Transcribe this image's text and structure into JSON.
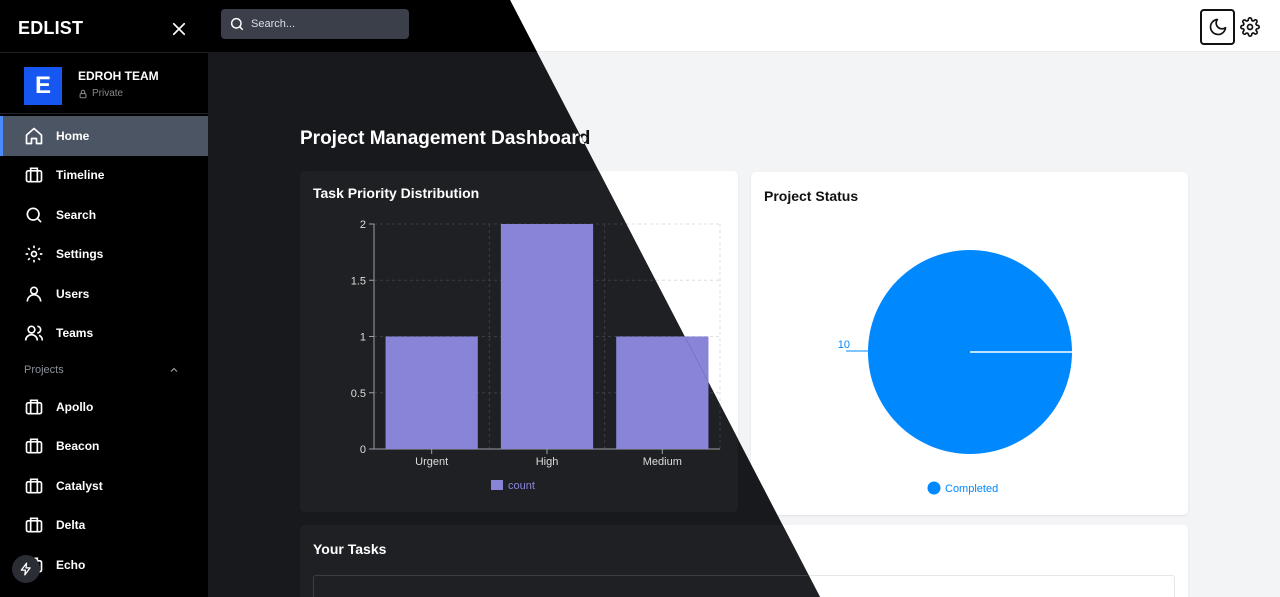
{
  "app": {
    "brand": "EDLIST"
  },
  "team": {
    "logo_letter": "E",
    "name": "EDROH TEAM",
    "visibility": "Private"
  },
  "search": {
    "placeholder": "Search..."
  },
  "nav": {
    "items": [
      {
        "label": "Home",
        "icon": "home-icon"
      },
      {
        "label": "Timeline",
        "icon": "briefcase-icon"
      },
      {
        "label": "Search",
        "icon": "search-icon"
      },
      {
        "label": "Settings",
        "icon": "gear-icon"
      },
      {
        "label": "Users",
        "icon": "user-icon"
      },
      {
        "label": "Teams",
        "icon": "users-icon"
      }
    ],
    "projects_label": "Projects",
    "projects": [
      {
        "label": "Apollo"
      },
      {
        "label": "Beacon"
      },
      {
        "label": "Catalyst"
      },
      {
        "label": "Delta"
      },
      {
        "label": "Echo"
      }
    ]
  },
  "page": {
    "title": "Project Management Dashboard"
  },
  "cards": {
    "priority_title": "Task Priority Distribution",
    "status_title": "Project Status",
    "tasks_title": "Your Tasks"
  },
  "chart_data": [
    {
      "type": "bar",
      "title": "Task Priority Distribution",
      "categories": [
        "Urgent",
        "High",
        "Medium"
      ],
      "series": [
        {
          "name": "count",
          "values": [
            1,
            2,
            1
          ]
        }
      ],
      "ylim": [
        0,
        2
      ],
      "yticks": [
        0,
        0.5,
        1,
        1.5,
        2
      ],
      "ytick_labels": [
        "0",
        "0.5",
        "1",
        "1.5",
        "2"
      ],
      "grid": true,
      "legend": "bottom",
      "color": "#8884d8"
    },
    {
      "type": "pie",
      "title": "Project Status",
      "slices": [
        {
          "label": "Completed",
          "value": 10
        }
      ],
      "data_labels": [
        "10"
      ],
      "legend": "bottom",
      "color": "#0088fe"
    }
  ]
}
